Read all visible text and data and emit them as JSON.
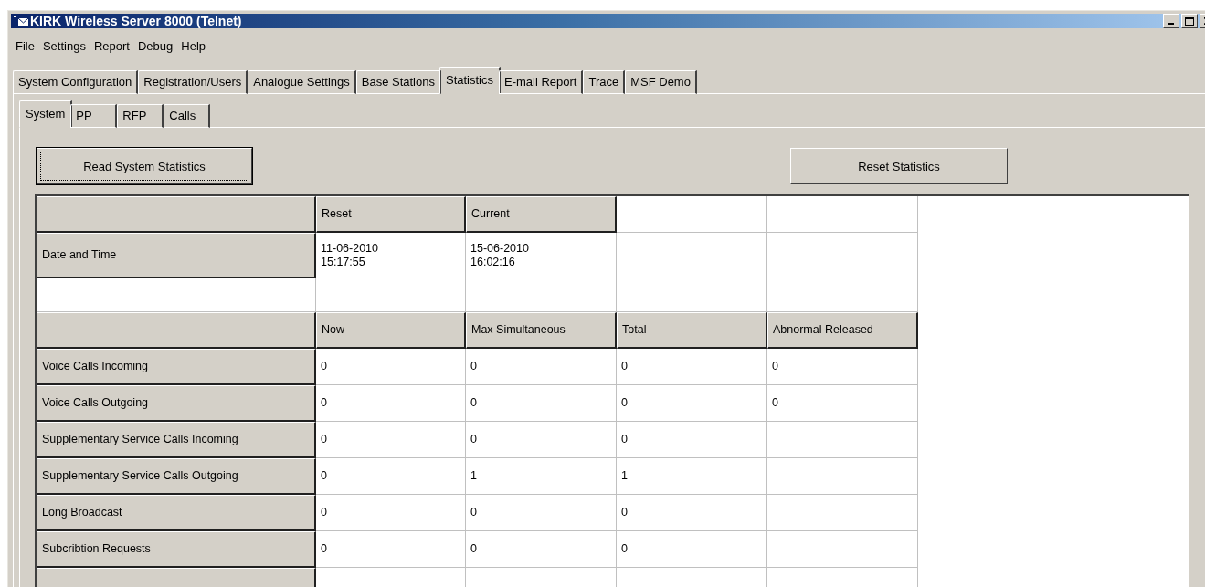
{
  "window": {
    "title": "KIRK Wireless Server 8000 (Telnet)"
  },
  "menu": [
    "File",
    "Settings",
    "Report",
    "Debug",
    "Help"
  ],
  "tabs": [
    {
      "label": "System Configuration",
      "selected": false
    },
    {
      "label": "Registration/Users",
      "selected": false
    },
    {
      "label": "Analogue Settings",
      "selected": false
    },
    {
      "label": "Base Stations",
      "selected": false
    },
    {
      "label": "Statistics",
      "selected": true
    },
    {
      "label": "E-mail Report",
      "selected": false
    },
    {
      "label": "Trace",
      "selected": false
    },
    {
      "label": "MSF Demo",
      "selected": false
    }
  ],
  "subtabs": [
    {
      "label": "System",
      "selected": true
    },
    {
      "label": "PP",
      "selected": false
    },
    {
      "label": "RFP",
      "selected": false
    },
    {
      "label": "Calls",
      "selected": false
    }
  ],
  "buttons": [
    {
      "label": "Read System Statistics",
      "focused": true
    },
    {
      "label": "Reset Statistics",
      "focused": false
    }
  ],
  "grid": {
    "rows": [
      {
        "kind": "header",
        "cells": [
          "Reset",
          "Current",
          null,
          null
        ]
      },
      {
        "kind": "data",
        "label": "Date and Time",
        "cells": [
          "11-06-2010\n15:17:55",
          "15-06-2010\n16:02:16",
          null,
          null
        ]
      },
      {
        "kind": "blank",
        "cells": [
          null,
          null,
          null,
          null
        ]
      },
      {
        "kind": "header",
        "cells": [
          "Now",
          "Max Simultaneous",
          "Total",
          "Abnormal Released"
        ]
      },
      {
        "kind": "data",
        "label": "Voice Calls Incoming",
        "cells": [
          "0",
          "0",
          "0",
          "0"
        ]
      },
      {
        "kind": "data",
        "label": "Voice Calls Outgoing",
        "cells": [
          "0",
          "0",
          "0",
          "0"
        ]
      },
      {
        "kind": "data",
        "label": "Supplementary Service Calls Incoming",
        "cells": [
          "0",
          "0",
          "0",
          null
        ]
      },
      {
        "kind": "data",
        "label": "Supplementary Service Calls Outgoing",
        "cells": [
          "0",
          "1",
          "1",
          null
        ]
      },
      {
        "kind": "data",
        "label": "Long Broadcast",
        "cells": [
          "0",
          "0",
          "0",
          null
        ]
      },
      {
        "kind": "data",
        "label": "Subcribtion Requests",
        "cells": [
          "0",
          "0",
          "0",
          null
        ]
      },
      {
        "kind": "data",
        "cells": [
          null,
          null,
          null,
          null
        ]
      }
    ]
  }
}
